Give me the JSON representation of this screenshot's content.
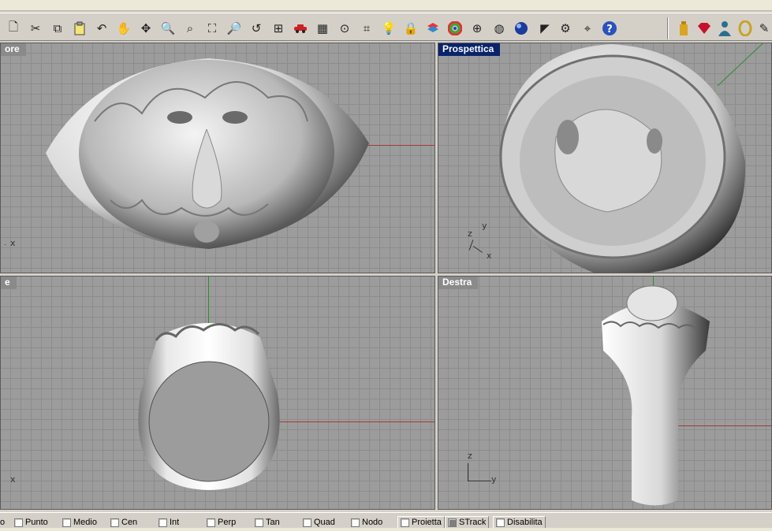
{
  "viewports": {
    "top": {
      "title": "ore",
      "axis_x": "x"
    },
    "perspective": {
      "title": "Prospettica",
      "axis_x": "x",
      "axis_y": "y",
      "axis_z": "z"
    },
    "front": {
      "title": "e",
      "axis_x": "x"
    },
    "right": {
      "title": "Destra",
      "axis_y": "y",
      "axis_z": "z"
    }
  },
  "toolbar": {
    "icons": [
      "new-document-icon",
      "cut-icon",
      "copy-icon",
      "paste-icon",
      "undo-icon",
      "pan-hand-icon",
      "rotate-view-icon",
      "zoom-icon",
      "zoom-window-icon",
      "zoom-extents-icon",
      "zoom-selected-icon",
      "undo-view-icon",
      "four-viewports-icon",
      "car-icon",
      "grid-plane-icon",
      "point-icon",
      "dimension-icon",
      "light-bulb-icon",
      "lock-icon",
      "layer-icon",
      "color-wheel-icon",
      "sphere-wire-icon",
      "sphere-mesh-icon",
      "sphere-render-icon",
      "render-icon",
      "settings-gear-icon",
      "osnap-icon",
      "help-icon",
      "bottle-icon",
      "gem-icon",
      "person-icon",
      "ring-icon",
      "brush-icon"
    ]
  },
  "statusbar": {
    "snaps": [
      {
        "label": "o",
        "checked": false
      },
      {
        "label": "Punto",
        "checked": false
      },
      {
        "label": "Medio",
        "checked": false
      },
      {
        "label": "Cen",
        "checked": false
      },
      {
        "label": "Int",
        "checked": false
      },
      {
        "label": "Perp",
        "checked": false
      },
      {
        "label": "Tan",
        "checked": false
      },
      {
        "label": "Quad",
        "checked": false
      },
      {
        "label": "Nodo",
        "checked": false
      },
      {
        "label": "Proietta",
        "checked": false
      },
      {
        "label": "STrack",
        "checked": true
      },
      {
        "label": "Disabilita",
        "checked": false
      }
    ]
  },
  "colors": {
    "active_title": "#0a246a",
    "inactive_title": "#8a8a8a",
    "viewport_bg": "#9c9c9c",
    "axis_x": "#a23a3a",
    "axis_y": "#2e8b2e"
  }
}
